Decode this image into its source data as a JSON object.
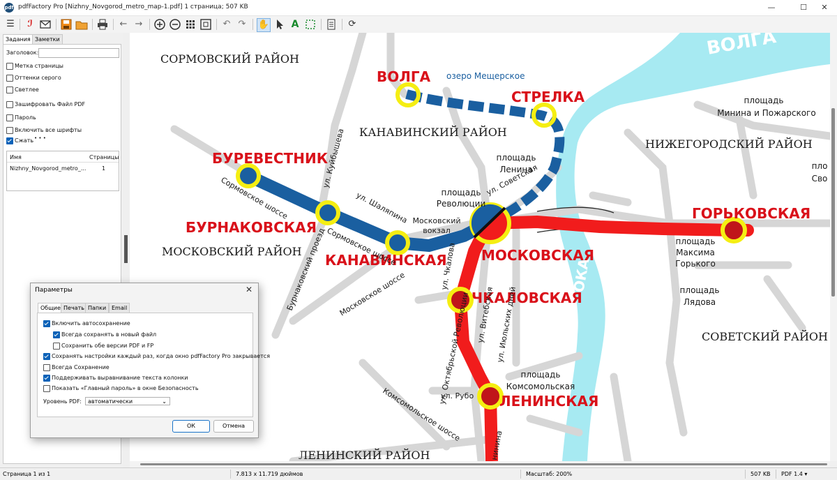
{
  "window": {
    "title": "pdfFactory Pro [Nizhny_Novgorod_metro_map-1.pdf] 1 страница; 507 KB",
    "app_icon": "pdf",
    "minimize": "—",
    "maximize": "☐",
    "close": "✕"
  },
  "toolbar": {
    "icons": [
      "menu-icon",
      "pdf-icon",
      "email-icon",
      "save-icon",
      "open-folder-icon",
      "print-icon",
      "back-arrow-icon",
      "forward-arrow-icon",
      "zoom-in-icon",
      "zoom-out-icon",
      "thumbnails-icon",
      "fit-page-icon",
      "undo-icon",
      "redo-icon",
      "hand-tool-icon",
      "select-arrow-icon",
      "text-tool-icon",
      "marquee-select-icon",
      "document-icon",
      "refresh-icon"
    ]
  },
  "sidebar": {
    "tabs": [
      "Задания",
      "Заметки"
    ],
    "header_label": "Заголовок:",
    "header_value": "",
    "options": [
      {
        "label": "Метка страницы",
        "checked": false
      },
      {
        "label": "Оттенки серого",
        "checked": false
      },
      {
        "label": "Светлее",
        "checked": false
      },
      {
        "label": "Зашифровать Файл PDF",
        "checked": false
      },
      {
        "label": "Пароль",
        "checked": false
      },
      {
        "label": "Включить все шрифты",
        "checked": false
      },
      {
        "label": "Сжать",
        "checked": true
      }
    ],
    "more": "• • •",
    "list": {
      "col_name": "Имя",
      "col_pages": "Страницы",
      "rows": [
        {
          "name": "Nizhny_Novgorod_metro_...",
          "pages": "1"
        }
      ]
    }
  },
  "map": {
    "districts": {
      "sormovsky": "СОРМОВСКИЙ РАЙОН",
      "kanavinsky": "КАНАВИНСКИЙ РАЙОН",
      "nizhegorodsky": "НИЖЕГОРОДСКИЙ РАЙОН",
      "moskovsky": "МОСКОВСКИЙ РАЙОН",
      "sovetsky": "СОВЕТСКИЙ РАЙОН",
      "leninsky": "ЛЕНИНСКИЙ РАЙОН"
    },
    "rivers": {
      "volga": "ВОЛГА",
      "oka": "ОКА",
      "lake": "озеро Мещерское"
    },
    "stations": {
      "volga": "ВОЛГА",
      "strelka": "СТРЕЛКА",
      "burevestnik": "БУРЕВЕСТНИК",
      "burnakovskaya": "БУРНАКОВСКАЯ",
      "kanavinskaya": "КАНАВИНСКАЯ",
      "moskovskaya": "МОСКОВСКАЯ",
      "gorkovskaya": "ГОРЬКОВСКАЯ",
      "chkalovskaya": "ЧКАЛОВСКАЯ",
      "leninskaya": "ЛЕНИНСКАЯ"
    },
    "places": {
      "minina_1": "площадь",
      "minina_2": "Минина и Пожарского",
      "lenina_1": "площадь",
      "lenina_2": "Ленина",
      "revolyutsii_1": "площадь",
      "revolyutsii_2": "Революции",
      "vokzal_1": "Московский",
      "vokzal_2": "вокзал",
      "gorkogo_1": "площадь",
      "gorkogo_2": "Максима",
      "gorkogo_3": "Горького",
      "lyadova_1": "площадь",
      "lyadova_2": "Лядова",
      "komsomolskaya_1": "площадь",
      "komsomolskaya_2": "Комсомольская",
      "edge_1": "пло",
      "edge_2": "Сво"
    },
    "streets": {
      "sormovskoe_1": "Сормовское шоссе",
      "sormovskoe_2": "Сормовское шоссе",
      "kuibysheva": "ул. Куйбышева",
      "shalyapina": "ул. Шаляпина",
      "sovetskaya": "ул. Советская",
      "burnakovsky": "Бурнаковский проезд",
      "moskovskoe": "Московское шоссе",
      "chkalova": "ул. Чкалова",
      "vitebskaya": "ул. Витебская",
      "iyulskikh": "ул. Июльских дней",
      "oktyabrskoy": "ул. Октябрьской Революции",
      "rubo": "ул. Рубо",
      "komsomolskoe": "Комсомольское шоссе",
      "edge": "нинина"
    }
  },
  "dialog": {
    "title": "Параметры",
    "close": "✕",
    "tabs": [
      "Общие",
      "Печать",
      "Папки",
      "Email"
    ],
    "options": [
      {
        "label": "Включить автосохранение",
        "checked": true
      },
      {
        "label": "Всегда сохранять в новый файл",
        "checked": true
      },
      {
        "label": "Сохранить обе версии PDF и FP",
        "checked": false
      },
      {
        "label": "Сохранять настройки каждый раз, когда окно pdfFactory Pro закрывается",
        "checked": true
      },
      {
        "label": "Всегда Сохранение",
        "checked": false
      },
      {
        "label": "Поддерживать выравнивание текста колонки",
        "checked": true
      },
      {
        "label": "Показать «Главный пароль» в окне Безопасность",
        "checked": false
      }
    ],
    "pdf_level_label": "Уровень PDF:",
    "pdf_level_value": "автоматически",
    "ok": "ОК",
    "cancel": "Отмена"
  },
  "status": {
    "page": "Страница 1 из 1",
    "size": "7.813 x 11.719 дюймов",
    "zoom": "Масштаб: 200%",
    "file_size": "507 KB",
    "pdf_version": "PDF 1.4 ▾"
  },
  "colors": {
    "red_line": "#f11c1c",
    "blue_line": "#1a5fa0",
    "river": "#a7eaf2",
    "road": "#d6d6d6",
    "station_ring": "#f5ee12",
    "label_red": "#d9111a",
    "accent": "#0b62b8"
  }
}
